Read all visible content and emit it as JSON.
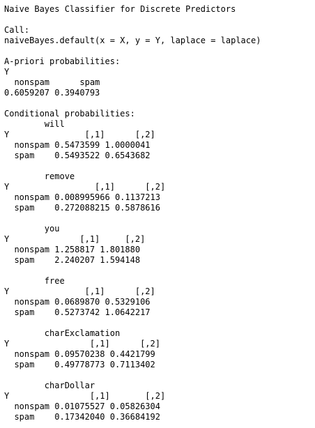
{
  "title": "Naive Bayes Classifier for Discrete Predictors",
  "call": {
    "label": "Call:",
    "expression": "naiveBayes.default(x = X, y = Y, laplace = laplace)"
  },
  "apriori": {
    "heading": "A-priori probabilities:",
    "dimname": "Y",
    "header": "  nonspam      spam",
    "values": "0.6059207 0.3940793"
  },
  "conditional_heading": "Conditional probabilities:",
  "predictors": [
    {
      "name": "        will",
      "header": "Y               [,1]      [,2]",
      "nonspam": "  nonspam 0.5473599 1.0000041",
      "spam": "  spam    0.5493522 0.6543682"
    },
    {
      "name": "        remove",
      "header": "Y                 [,1]      [,2]",
      "nonspam": "  nonspam 0.008995966 0.1137213",
      "spam": "  spam    0.272088215 0.5878616"
    },
    {
      "name": "        you",
      "header": "Y              [,1]     [,2]",
      "nonspam": "  nonspam 1.258817 1.801880",
      "spam": "  spam    2.240207 1.594148"
    },
    {
      "name": "        free",
      "header": "Y               [,1]      [,2]",
      "nonspam": "  nonspam 0.0689870 0.5329106",
      "spam": "  spam    0.5273742 1.0642217"
    },
    {
      "name": "        charExclamation",
      "header": "Y                [,1]      [,2]",
      "nonspam": "  nonspam 0.09570238 0.4421799",
      "spam": "  spam    0.49778773 0.7113402"
    },
    {
      "name": "        charDollar",
      "header": "Y                [,1]       [,2]",
      "nonspam": "  nonspam 0.01075527 0.05826304",
      "spam": "  spam    0.17342040 0.36684192"
    }
  ]
}
